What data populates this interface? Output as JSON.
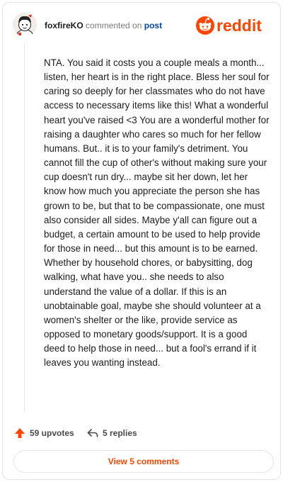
{
  "header": {
    "username": "foxfireKO",
    "verb": "commented on",
    "post_link": "post",
    "logo_text": "reddit",
    "brand_color": "#ff4500"
  },
  "comment": {
    "text": "NTA. You said it costs you a couple meals a month... listen, her heart is in the right place. Bless her soul for caring so deeply for her classmates who do not have access to necessary items like this! What a wonderful heart you've raised <3 You are a wonderful mother for raising a daughter who cares so much for her fellow humans. But.. it is to your family's detriment. You cannot fill the cup of other's without making sure your cup doesn't run dry... maybe sit her down, let her know how much you appreciate the person she has grown to be, but that to be compassionate, one must also consider all sides. Maybe y'all can figure out a budget, a certain amount to be used to help provide for those in need... but this amount is to be earned. Whether by household chores, or babysitting, dog walking, what have you.. she needs to also understand the value of a dollar. If this is an unobtainable goal, maybe she should volunteer at a women's shelter or the like, provide service as opposed to monetary goods/support. It is a good deed to help those in need... but a fool's errand if it leaves you wanting instead."
  },
  "actions": {
    "upvotes": "59 upvotes",
    "replies": "5 replies",
    "upvote_icon": "upvote-arrow-icon",
    "reply_icon": "reply-arrow-icon"
  },
  "view_button": {
    "label": "View 5 comments"
  }
}
